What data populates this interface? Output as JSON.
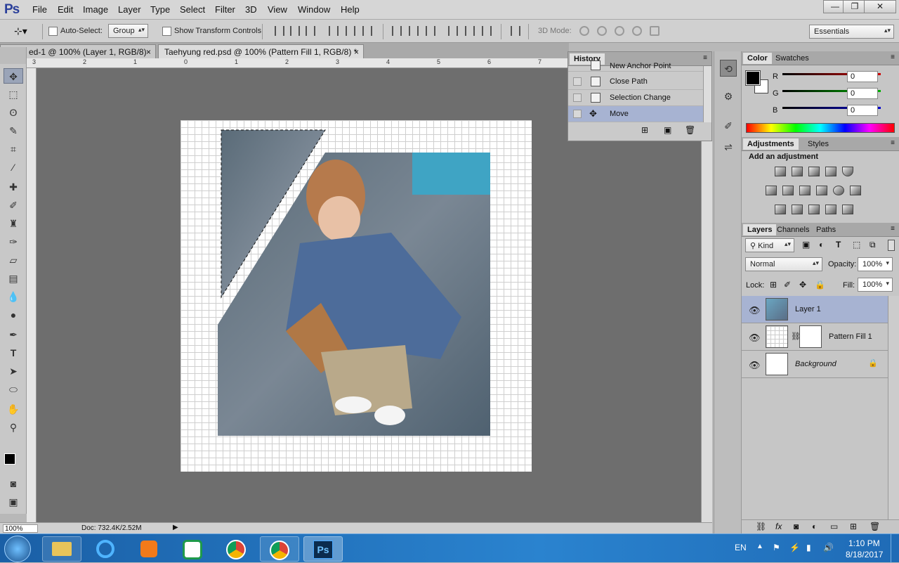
{
  "app": {
    "logo": "Ps"
  },
  "menu": [
    "File",
    "Edit",
    "Image",
    "Layer",
    "Type",
    "Select",
    "Filter",
    "3D",
    "View",
    "Window",
    "Help"
  ],
  "window_controls": {
    "minimize": "—",
    "restore": "❐",
    "close": "✕"
  },
  "options": {
    "auto_select_label": "Auto-Select:",
    "auto_select_value": "Group",
    "transform_label": "Show Transform Controls",
    "mode_3d_label": "3D Mode:",
    "workspace": "Essentials"
  },
  "tabs": [
    {
      "label": "ed-1 @ 100% (Layer 1, RGB/8) *",
      "close": "×"
    },
    {
      "label": "Taehyung red.psd @ 100% (Pattern Fill 1, RGB/8) *",
      "close": "×"
    }
  ],
  "ruler_numbers": [
    "3",
    "2",
    "1",
    "0",
    "1",
    "2",
    "3",
    "4",
    "5",
    "6",
    "7"
  ],
  "history": {
    "title": "History",
    "items": [
      "New Anchor Point",
      "Close Path",
      "Selection Change",
      "Move"
    ],
    "selected_index": 3
  },
  "color_panel": {
    "tabs": [
      "Color",
      "Swatches"
    ],
    "channels": [
      {
        "label": "R",
        "value": "0",
        "color": "#d00000"
      },
      {
        "label": "G",
        "value": "0",
        "color": "#00b000"
      },
      {
        "label": "B",
        "value": "0",
        "color": "#0000d0"
      }
    ]
  },
  "adjustments": {
    "tabs": [
      "Adjustments",
      "Styles"
    ],
    "heading": "Add an adjustment",
    "icon_names": [
      "brightness",
      "levels",
      "curves",
      "exposure",
      "vibrance",
      "hue-saturation",
      "color-balance",
      "black-white",
      "photo-filter",
      "channel-mixer",
      "color-lookup",
      "invert",
      "posterize",
      "threshold",
      "selective-color",
      "gradient-map"
    ]
  },
  "layers_panel": {
    "tabs": [
      "Layers",
      "Channels",
      "Paths"
    ],
    "filter_kind": "Kind",
    "blend_mode": "Normal",
    "opacity_label": "Opacity:",
    "opacity": "100%",
    "lock_label": "Lock:",
    "fill_label": "Fill:",
    "fill": "100%",
    "layers": [
      {
        "name": "Layer 1",
        "selected": true
      },
      {
        "name": "Pattern Fill 1",
        "selected": false
      },
      {
        "name": "Background",
        "selected": false
      }
    ]
  },
  "status": {
    "zoom": "100%",
    "doc": "Doc: 732.4K/2.52M"
  },
  "taskbar": {
    "lang": "EN",
    "time": "1:10 PM",
    "date": "8/18/2017"
  }
}
